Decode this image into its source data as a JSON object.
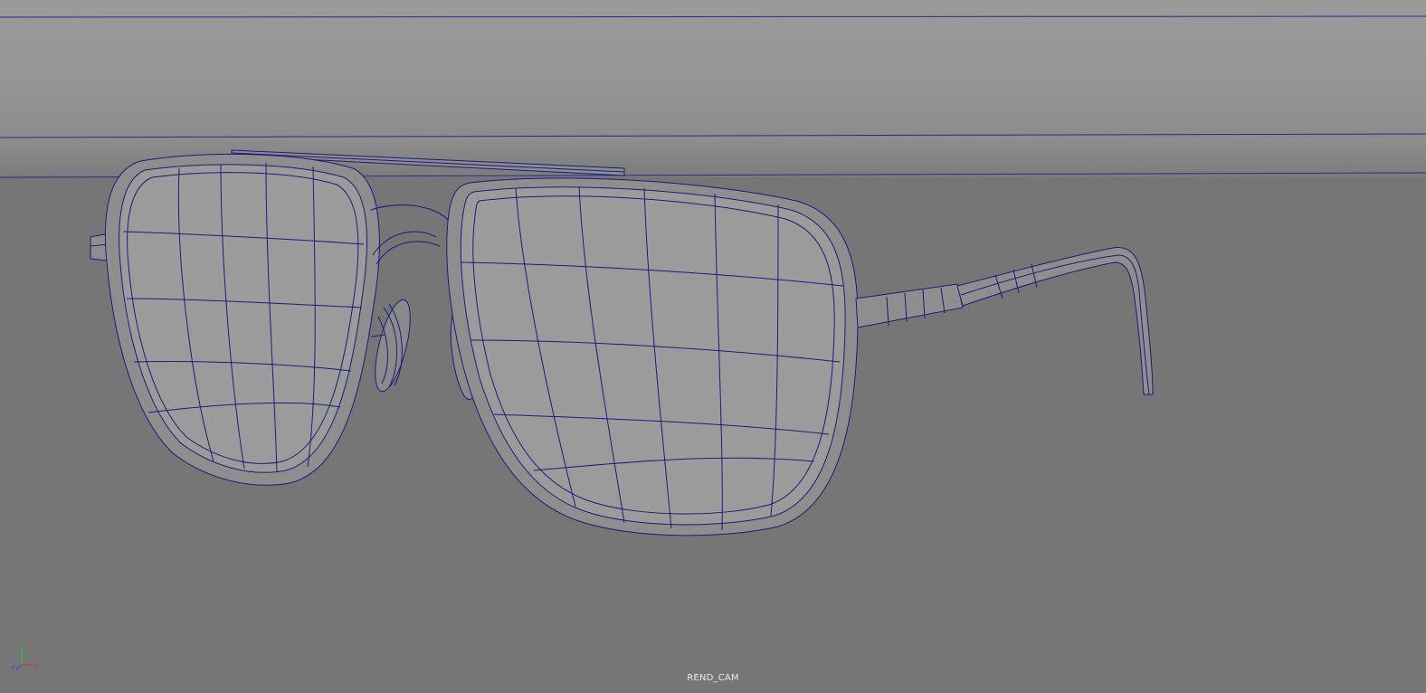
{
  "viewport": {
    "camera_name": "REND_CAM",
    "background_color": "#767676",
    "wall_color": "#9a9a9a",
    "wire_color": "#1b1b7a",
    "surface_color": "#9a9a9a"
  },
  "axis_gizmo": {
    "x_label": "x",
    "y_label": "y",
    "z_label": "z",
    "x_color": "#e03030",
    "y_color": "#30c030",
    "z_color": "#3050e0"
  }
}
